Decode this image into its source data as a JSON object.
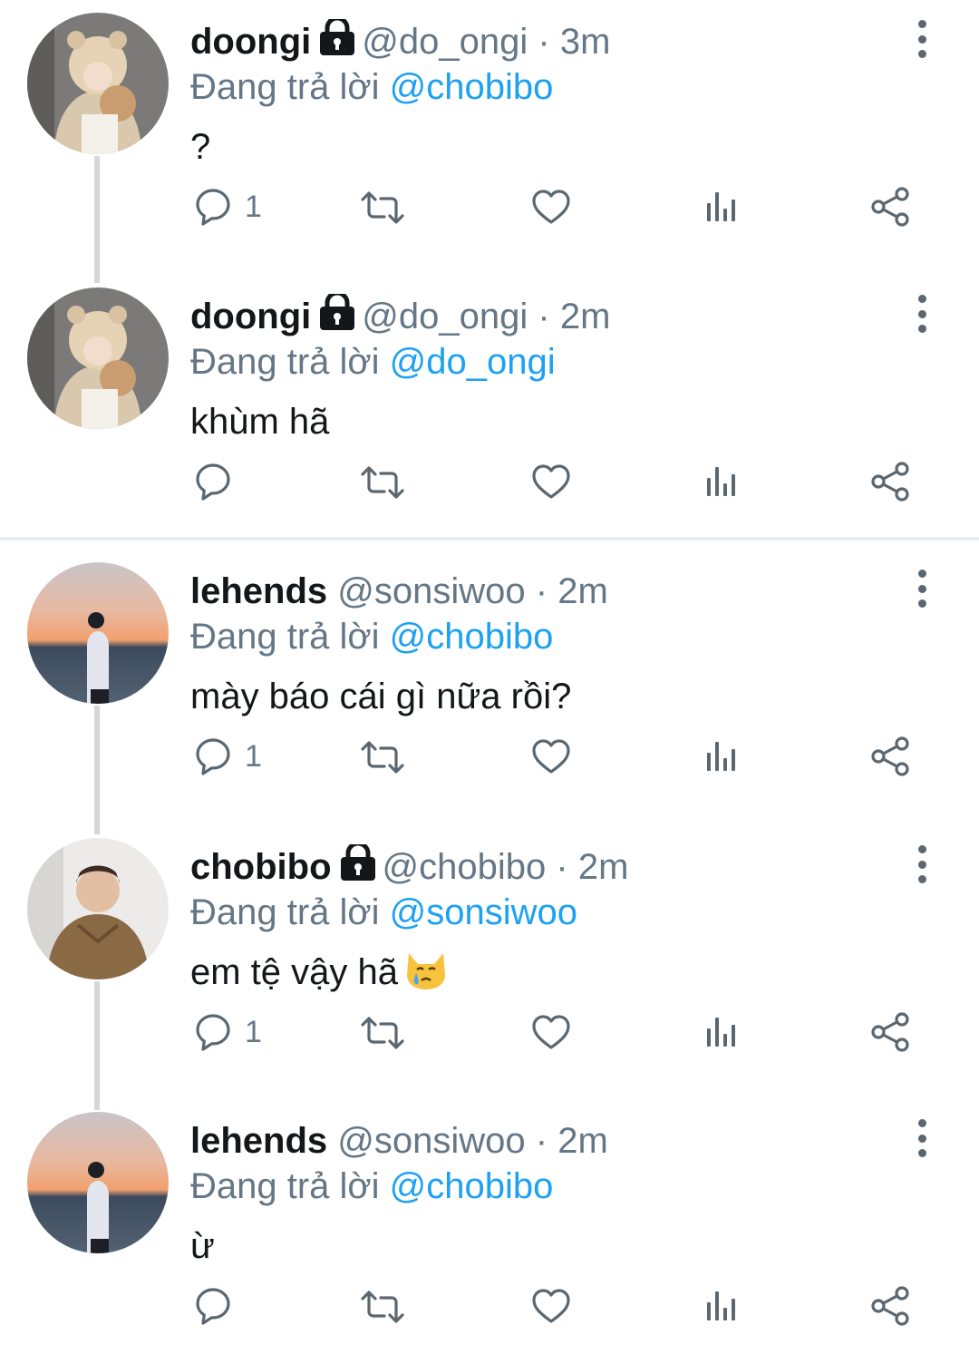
{
  "colors": {
    "mention": "#1da1f2",
    "secondary": "#657786",
    "text": "#14171a",
    "icon": "#5b6770",
    "divider": "#e6ecf0"
  },
  "tweets": [
    {
      "name": "doongi",
      "locked": true,
      "handle": "@do_ongi",
      "dot": "·",
      "time": "3m",
      "reply_prefix": "Đang trả lời",
      "reply_to": "@chobibo",
      "text": "?",
      "reply_count": "1",
      "avatar": "bear-hat-avatar"
    },
    {
      "name": "doongi",
      "locked": true,
      "handle": "@do_ongi",
      "dot": "·",
      "time": "2m",
      "reply_prefix": "Đang trả lời",
      "reply_to": "@do_ongi",
      "text": "khùm hã",
      "reply_count": "",
      "avatar": "bear-hat-avatar"
    },
    {
      "name": "lehends",
      "locked": false,
      "handle": "@sonsiwoo",
      "dot": "·",
      "time": "2m",
      "reply_prefix": "Đang trả lời",
      "reply_to": "@chobibo",
      "text": "mày báo cái gì nữa rồi?",
      "reply_count": "1",
      "avatar": "sunset-avatar"
    },
    {
      "name": "chobibo",
      "locked": true,
      "handle": "@chobibo",
      "dot": "·",
      "time": "2m",
      "reply_prefix": "Đang trả lời",
      "reply_to": "@sonsiwoo",
      "text": "em tệ vậy hã",
      "emoji": "crying-cat-emoji",
      "reply_count": "1",
      "avatar": "snow-jacket-avatar"
    },
    {
      "name": "lehends",
      "locked": false,
      "handle": "@sonsiwoo",
      "dot": "·",
      "time": "2m",
      "reply_prefix": "Đang trả lời",
      "reply_to": "@chobibo",
      "text": "ừ",
      "reply_count": "",
      "avatar": "sunset-avatar"
    }
  ]
}
